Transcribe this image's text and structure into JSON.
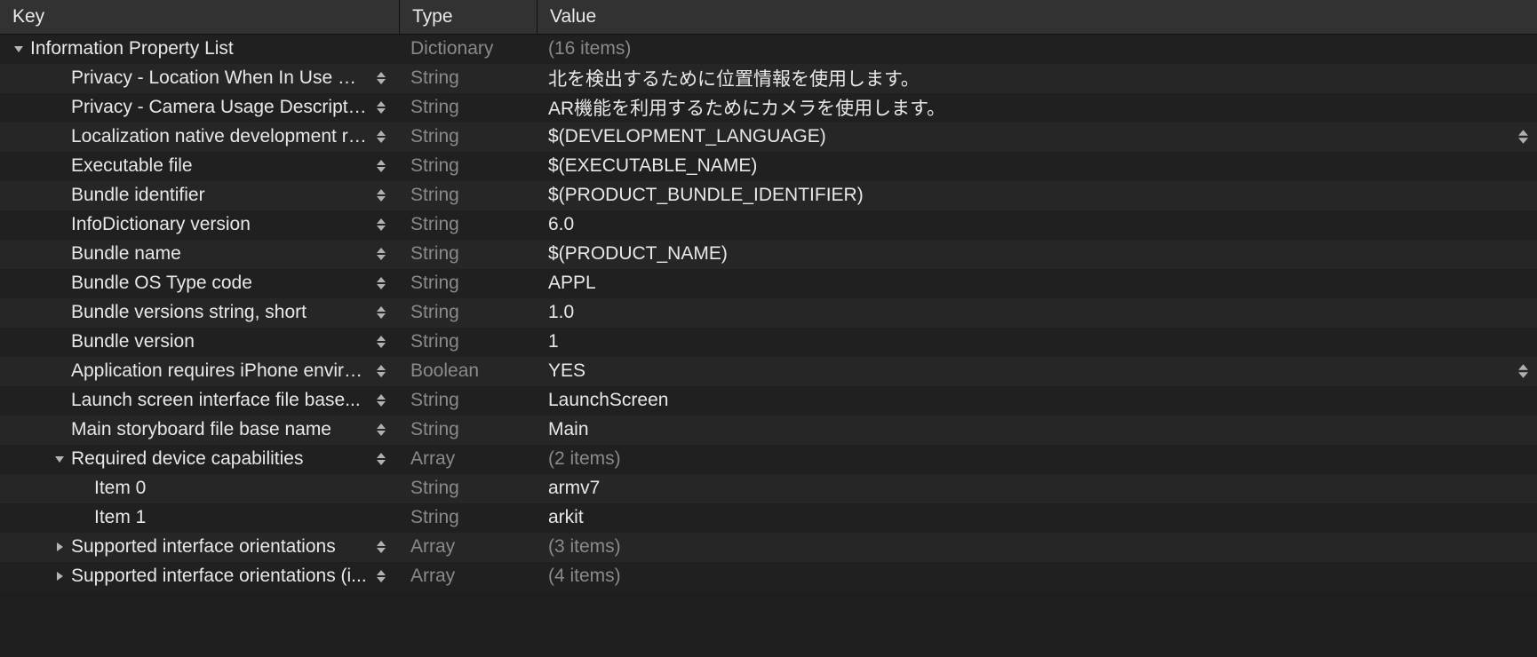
{
  "columns": {
    "key": "Key",
    "type": "Type",
    "value": "Value"
  },
  "rows": [
    {
      "indent": 0,
      "disclosure": "down",
      "key": "Information Property List",
      "stepper": false,
      "type": "Dictionary",
      "type_muted": true,
      "value": "(16 items)",
      "value_muted": true,
      "value_stepper": false
    },
    {
      "indent": 1,
      "disclosure": "none",
      "key": "Privacy - Location When In Use Us...",
      "stepper": true,
      "type": "String",
      "type_muted": true,
      "value": "北を検出するために位置情報を使用します。",
      "value_muted": false,
      "value_stepper": false
    },
    {
      "indent": 1,
      "disclosure": "none",
      "key": "Privacy - Camera Usage Description",
      "stepper": true,
      "type": "String",
      "type_muted": true,
      "value": "AR機能を利用するためにカメラを使用します。",
      "value_muted": false,
      "value_stepper": false
    },
    {
      "indent": 1,
      "disclosure": "none",
      "key": "Localization native development re...",
      "stepper": true,
      "type": "String",
      "type_muted": true,
      "value": "$(DEVELOPMENT_LANGUAGE)",
      "value_muted": false,
      "value_stepper": true
    },
    {
      "indent": 1,
      "disclosure": "none",
      "key": "Executable file",
      "stepper": true,
      "type": "String",
      "type_muted": true,
      "value": "$(EXECUTABLE_NAME)",
      "value_muted": false,
      "value_stepper": false
    },
    {
      "indent": 1,
      "disclosure": "none",
      "key": "Bundle identifier",
      "stepper": true,
      "type": "String",
      "type_muted": true,
      "value": "$(PRODUCT_BUNDLE_IDENTIFIER)",
      "value_muted": false,
      "value_stepper": false
    },
    {
      "indent": 1,
      "disclosure": "none",
      "key": "InfoDictionary version",
      "stepper": true,
      "type": "String",
      "type_muted": true,
      "value": "6.0",
      "value_muted": false,
      "value_stepper": false
    },
    {
      "indent": 1,
      "disclosure": "none",
      "key": "Bundle name",
      "stepper": true,
      "type": "String",
      "type_muted": true,
      "value": "$(PRODUCT_NAME)",
      "value_muted": false,
      "value_stepper": false
    },
    {
      "indent": 1,
      "disclosure": "none",
      "key": "Bundle OS Type code",
      "stepper": true,
      "type": "String",
      "type_muted": true,
      "value": "APPL",
      "value_muted": false,
      "value_stepper": false
    },
    {
      "indent": 1,
      "disclosure": "none",
      "key": "Bundle versions string, short",
      "stepper": true,
      "type": "String",
      "type_muted": true,
      "value": "1.0",
      "value_muted": false,
      "value_stepper": false
    },
    {
      "indent": 1,
      "disclosure": "none",
      "key": "Bundle version",
      "stepper": true,
      "type": "String",
      "type_muted": true,
      "value": "1",
      "value_muted": false,
      "value_stepper": false
    },
    {
      "indent": 1,
      "disclosure": "none",
      "key": "Application requires iPhone enviro...",
      "stepper": true,
      "type": "Boolean",
      "type_muted": true,
      "value": "YES",
      "value_muted": false,
      "value_stepper": true
    },
    {
      "indent": 1,
      "disclosure": "none",
      "key": "Launch screen interface file base...",
      "stepper": true,
      "type": "String",
      "type_muted": true,
      "value": "LaunchScreen",
      "value_muted": false,
      "value_stepper": false
    },
    {
      "indent": 1,
      "disclosure": "none",
      "key": "Main storyboard file base name",
      "stepper": true,
      "type": "String",
      "type_muted": true,
      "value": "Main",
      "value_muted": false,
      "value_stepper": false
    },
    {
      "indent": 1,
      "disclosure": "down",
      "key": "Required device capabilities",
      "stepper": true,
      "type": "Array",
      "type_muted": true,
      "value": "(2 items)",
      "value_muted": true,
      "value_stepper": false
    },
    {
      "indent": 2,
      "disclosure": "none",
      "key": "Item 0",
      "stepper": false,
      "type": "String",
      "type_muted": true,
      "value": "armv7",
      "value_muted": false,
      "value_stepper": false
    },
    {
      "indent": 2,
      "disclosure": "none",
      "key": "Item 1",
      "stepper": false,
      "type": "String",
      "type_muted": true,
      "value": "arkit",
      "value_muted": false,
      "value_stepper": false
    },
    {
      "indent": 1,
      "disclosure": "right",
      "key": "Supported interface orientations",
      "stepper": true,
      "type": "Array",
      "type_muted": true,
      "value": "(3 items)",
      "value_muted": true,
      "value_stepper": false
    },
    {
      "indent": 1,
      "disclosure": "right",
      "key": "Supported interface orientations (i...",
      "stepper": true,
      "type": "Array",
      "type_muted": true,
      "value": "(4 items)",
      "value_muted": true,
      "value_stepper": false
    }
  ]
}
